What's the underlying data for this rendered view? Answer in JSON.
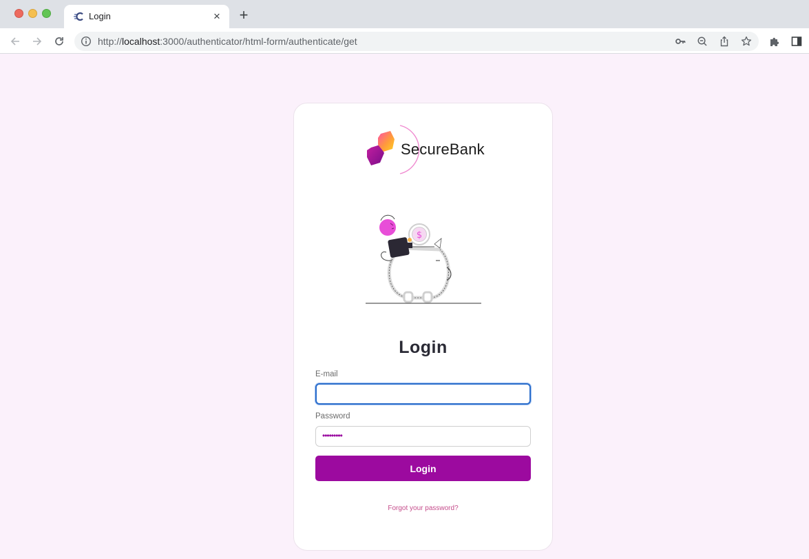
{
  "browser": {
    "tab_title": "Login",
    "tab_favicon": "C",
    "new_tab_label": "+",
    "close_tab_label": "×",
    "url_scheme": "http://",
    "url_host": "localhost",
    "url_path": ":3000/authenticator/html-form/authenticate/get"
  },
  "brand": {
    "name": "SecureBank"
  },
  "form": {
    "title": "Login",
    "email_label": "E-mail",
    "email_value": "",
    "password_label": "Password",
    "password_mask": "•••••••••",
    "submit_label": "Login",
    "forgot_link": "Forgot your password?"
  },
  "colors": {
    "primary": "#9c0a9f",
    "link": "#c54c8b",
    "page_background": "#fbf1fb",
    "focus_ring": "#2c6ecb"
  },
  "icons": [
    "back-arrow-icon",
    "forward-arrow-icon",
    "reload-icon",
    "info-icon",
    "key-icon",
    "zoom-icon",
    "share-icon",
    "star-icon",
    "extensions-icon",
    "side-panel-icon"
  ]
}
